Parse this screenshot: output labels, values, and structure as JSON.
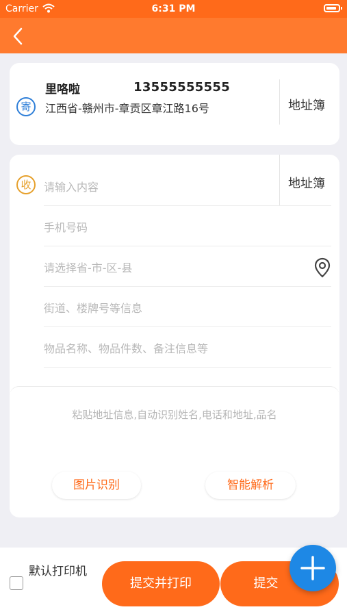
{
  "status_bar": {
    "carrier": "Carrier",
    "time": "6:31 PM"
  },
  "sender": {
    "tag": "寄",
    "name": "里咯啦",
    "phone": "13555555555",
    "address": "江西省-赣州市-章贡区章江路16号",
    "address_book_label": "地址簿"
  },
  "receiver": {
    "tag": "收",
    "name_placeholder": "请输入内容",
    "address_book_label": "地址簿",
    "phone_placeholder": "手机号码",
    "region_placeholder": "请选择省-市-区-县",
    "street_placeholder": "街道、楼牌号等信息",
    "goods_placeholder": "物品名称、物品件数、备注信息等"
  },
  "paste": {
    "placeholder": "粘贴地址信息,自动识别姓名,电话和地址,品名",
    "image_recognize_label": "图片识别",
    "smart_parse_label": "智能解析"
  },
  "bottom": {
    "default_printer_label": "默认打印机",
    "submit_print_label": "提交并打印",
    "submit_label": "提交"
  },
  "colors": {
    "brand": "#ff6a1a",
    "fab": "#1e88e5",
    "sender_tag": "#2f7fd8",
    "receiver_tag": "#e6a02b"
  },
  "icons": [
    "wifi-icon",
    "battery-icon",
    "back-arrow-icon",
    "location-pin-icon",
    "plus-icon"
  ]
}
